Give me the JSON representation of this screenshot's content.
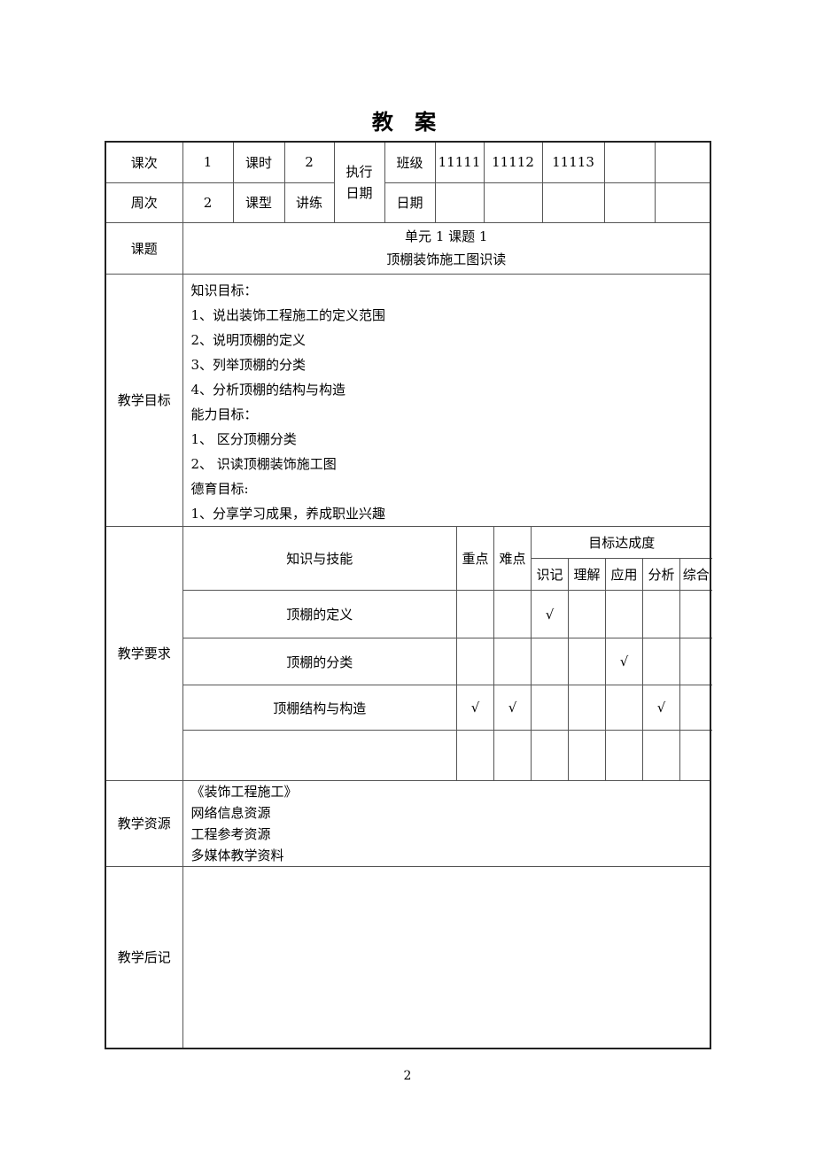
{
  "title": "教 案",
  "header": {
    "row1": {
      "lesson_no_label": "课次",
      "lesson_no": "1",
      "hours_label": "课时",
      "hours": "2",
      "exec_date_label": "执行\n日期",
      "class_label": "班级",
      "classes": [
        "11111",
        "11112",
        "11113",
        "",
        ""
      ]
    },
    "row2": {
      "week_label": "周次",
      "week": "2",
      "type_label": "课型",
      "type": "讲练",
      "date_label": "日期",
      "dates": [
        "",
        "",
        "",
        "",
        ""
      ]
    }
  },
  "topic": {
    "label": "课题",
    "line1": "单元 1 课题 1",
    "line2": "顶棚装饰施工图识读"
  },
  "objectives": {
    "label": "教学目标",
    "lines": [
      "知识目标：",
      "1、说出装饰工程施工的定义范围",
      "2、说明顶棚的定义",
      "3、列举顶棚的分类",
      "4、分析顶棚的结构与构造",
      "能力目标：",
      "1、 区分顶棚分类",
      "2、 识读顶棚装饰施工图",
      "德育目标:",
      "1、分享学习成果，养成职业兴趣"
    ]
  },
  "requirements": {
    "label": "教学要求",
    "col_knowledge": "知识与技能",
    "col_key": "重点",
    "col_difficult": "难点",
    "col_goal": "目标达成度",
    "levels": [
      "识记",
      "理解",
      "应用",
      "分析",
      "综合"
    ],
    "rows": [
      {
        "item": "顶棚的定义",
        "key": "",
        "difficult": "",
        "levels": [
          "√",
          "",
          "",
          "",
          ""
        ]
      },
      {
        "item": "顶棚的分类",
        "key": "",
        "difficult": "",
        "levels": [
          "",
          "",
          "√",
          "",
          ""
        ]
      },
      {
        "item": "顶棚结构与构造",
        "key": "√",
        "difficult": "√",
        "levels": [
          "",
          "",
          "",
          "√",
          ""
        ]
      },
      {
        "item": "",
        "key": "",
        "difficult": "",
        "levels": [
          "",
          "",
          "",
          "",
          ""
        ]
      }
    ]
  },
  "resources": {
    "label": "教学资源",
    "lines": [
      "《装饰工程施工》",
      "网络信息资源",
      "工程参考资源",
      "多媒体教学资料"
    ]
  },
  "postscript": {
    "label": "教学后记",
    "content": ""
  },
  "page_number": "2"
}
